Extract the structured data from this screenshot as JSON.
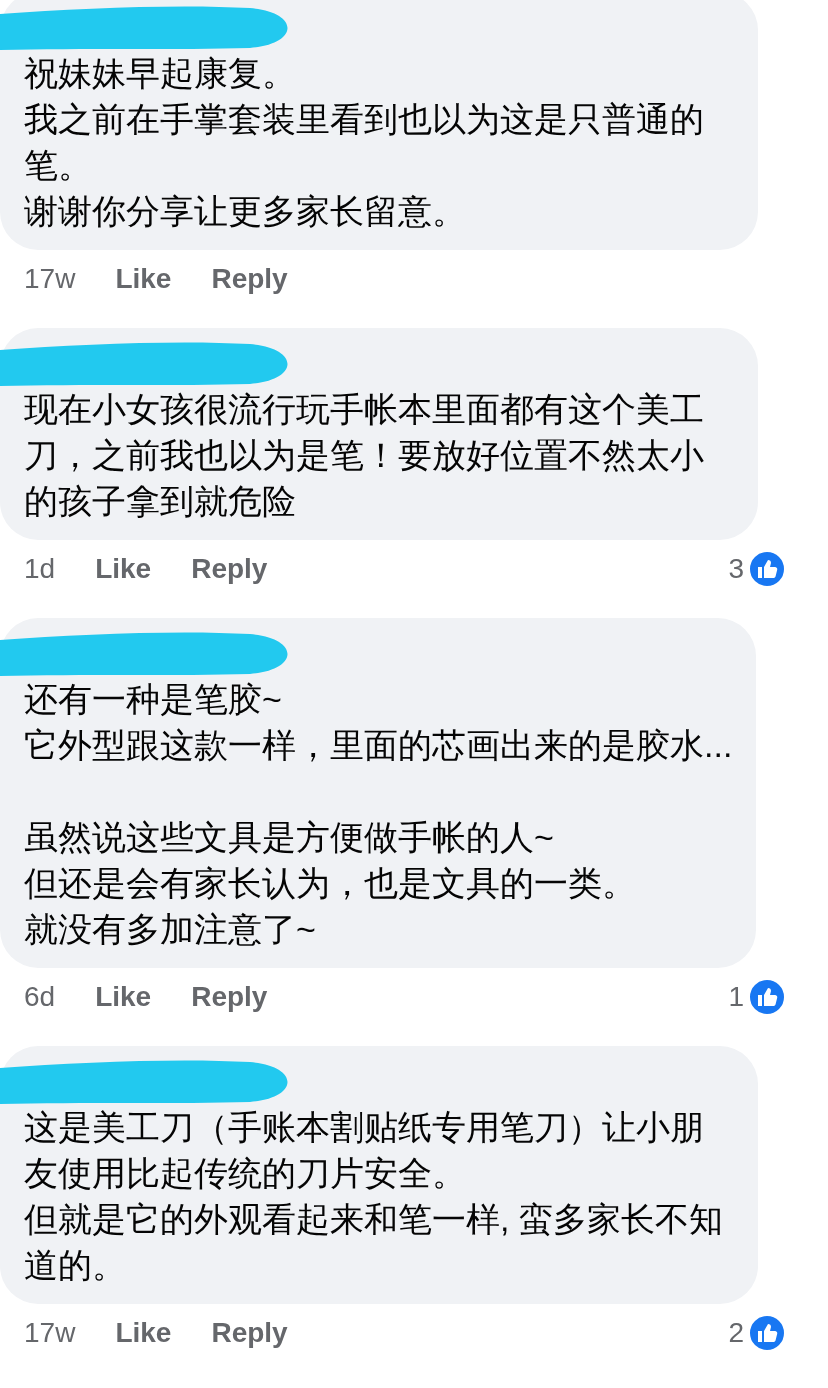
{
  "comments": [
    {
      "blocks": [
        [
          "祝妹妹早起康复。",
          "我之前在手掌套装里看到也以为这是只普通的笔。",
          "谢谢你分享让更多家长留意。"
        ]
      ],
      "time": "17w",
      "like": "Like",
      "reply": "Reply"
    },
    {
      "blocks": [
        [
          "现在小女孩很流行玩手帐本里面都有这个美工刀，之前我也以为是笔！要放好位置不然太小的孩子拿到就危险"
        ]
      ],
      "time": "1d",
      "like": "Like",
      "reply": "Reply",
      "reactions": "3"
    },
    {
      "blocks": [
        [
          "还有一种是笔胶~",
          "它外型跟这款一样，里面的芯画出来的是胶水..."
        ],
        [
          "虽然说这些文具是方便做手帐的人~",
          "但还是会有家长认为，也是文具的一类。",
          "就没有多加注意了~"
        ]
      ],
      "time": "6d",
      "like": "Like",
      "reply": "Reply",
      "reactions": "1"
    },
    {
      "blocks": [
        [
          "这是美工刀（手账本割贴纸专用笔刀）让小朋友使用比起传统的刀片安全。",
          "但就是它的外观看起来和笔一样, 蛮多家长不知道的。"
        ]
      ],
      "time": "17w",
      "like": "Like",
      "reply": "Reply",
      "reactions": "2"
    }
  ]
}
